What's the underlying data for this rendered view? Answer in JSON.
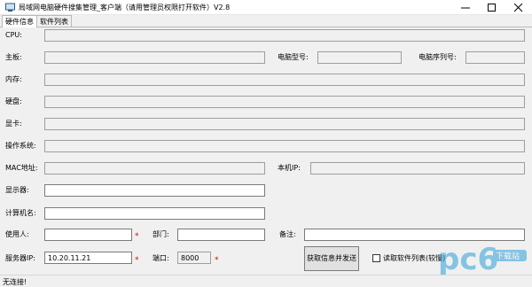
{
  "window": {
    "title": "局域网电脑硬件搜集管理_客户端（请用管理员权限打开软件）V2.8",
    "minimize_icon": "minimize-icon",
    "maximize_icon": "maximize-icon",
    "close_icon": "close-icon"
  },
  "tabs": [
    {
      "label": "硬件信息",
      "active": true
    },
    {
      "label": "软件列表",
      "active": false
    }
  ],
  "form": {
    "cpu_label": "CPU:",
    "cpu_value": "",
    "motherboard_label": "主板:",
    "motherboard_value": "",
    "pc_model_label": "电脑型号:",
    "pc_model_value": "",
    "pc_serial_label": "电脑序列号:",
    "pc_serial_value": "",
    "memory_label": "内存:",
    "memory_value": "",
    "disk_label": "硬盘:",
    "disk_value": "",
    "gpu_label": "显卡:",
    "gpu_value": "",
    "os_label": "操作系统:",
    "os_value": "",
    "mac_label": "MAC地址:",
    "mac_value": "",
    "local_ip_label": "本机IP:",
    "local_ip_value": "",
    "monitor_label": "显示器:",
    "monitor_value": "",
    "pc_name_label": "计算机名:",
    "pc_name_value": "",
    "user_label": "使用人:",
    "user_value": "",
    "dept_label": "部门:",
    "dept_value": "",
    "note_label": "备注:",
    "note_value": "",
    "server_ip_label": "服务器IP:",
    "server_ip_value": "10.20.11.21",
    "port_label": "端口:",
    "port_value": "8000",
    "required_mark": "*"
  },
  "actions": {
    "submit_label": "获取信息并发送",
    "read_software_label": "读取软件列表(较慢)",
    "read_software_checked": false
  },
  "status": {
    "text": "无连接!"
  },
  "watermark": {
    "text": "pc6",
    "sub": "下载站",
    "color": "#2f9fd8"
  }
}
